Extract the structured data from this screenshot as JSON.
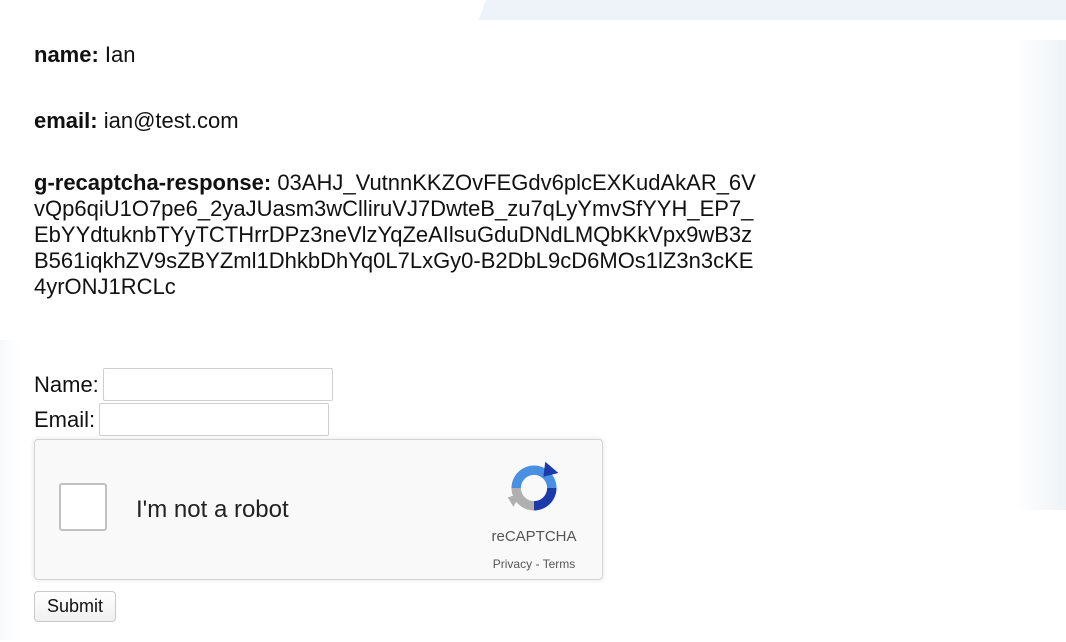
{
  "result": {
    "name": {
      "label": "name:",
      "value": "Ian"
    },
    "email": {
      "label": "email:",
      "value": "ian@test.com"
    },
    "recaptcha_response": {
      "label": "g-recaptcha-response:",
      "lines": [
        "03AHJ_VutnnKKZOvFEGdv6plcEXKudAkAR_6V",
        "vQp6qiU1O7pe6_2yaJUasm3wClliruVJ7DwteB_zu7qLyYmvSfYYH_EP7_",
        "EbYYdtuknbTYyTCTHrrDPz3neVlzYqZeAIlsuGduDNdLMQbKkVpx9wB3z",
        "B561iqkhZV9sZBYZml1DhkbDhYq0L7LxGy0-B2DbL9cD6MOs1lZ3n3cKE",
        "4yrONJ1RCLc"
      ]
    }
  },
  "form": {
    "name_label": "Name:",
    "name_value": "",
    "email_label": "Email:",
    "email_value": "",
    "recaptcha": {
      "checkbox_label": "I'm not a robot",
      "brand": "reCAPTCHA",
      "privacy": "Privacy",
      "separator": " - ",
      "terms": "Terms"
    },
    "submit_label": "Submit"
  },
  "colors": {
    "recaptcha_blue": "#4a90e2",
    "recaptcha_dark_blue": "#1c3aa9",
    "recaptcha_gray": "#b0b0b0"
  },
  "icons": {
    "recaptcha_logo": "recaptcha-logo-icon"
  }
}
